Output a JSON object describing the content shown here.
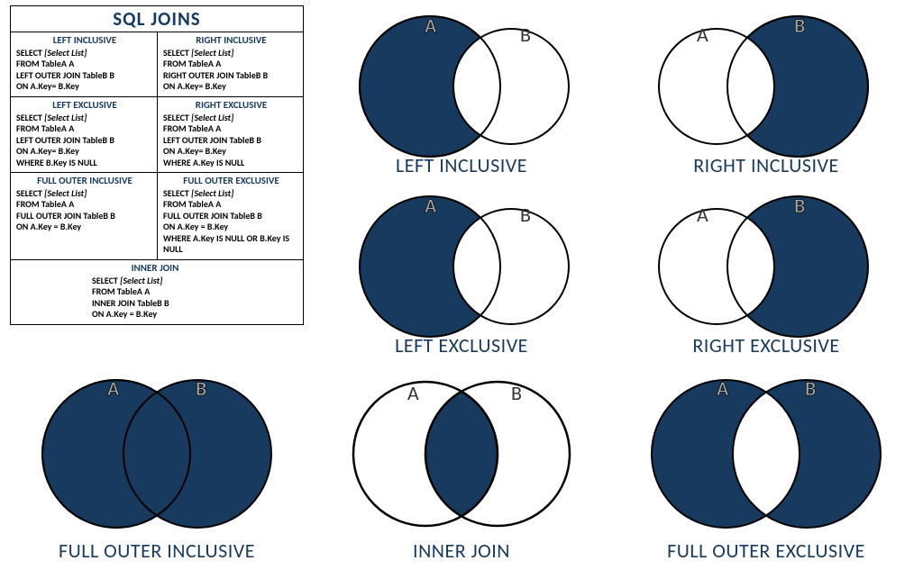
{
  "title": "SQL JOINS",
  "colors": {
    "fill": "#173a5e",
    "stroke": "#000",
    "bg": "#fff"
  },
  "venn": {
    "left_inclusive": {
      "label": "LEFT INCLUSIVE",
      "a": "A",
      "b": "B"
    },
    "right_inclusive": {
      "label": "RIGHT INCLUSIVE",
      "a": "A",
      "b": "B"
    },
    "left_exclusive": {
      "label": "LEFT EXCLUSIVE",
      "a": "A",
      "b": "B"
    },
    "right_exclusive": {
      "label": "RIGHT EXCLUSIVE",
      "a": "A",
      "b": "B"
    },
    "full_outer_inclusive": {
      "label": "FULL OUTER INCLUSIVE",
      "a": "A",
      "b": "B"
    },
    "inner_join": {
      "label": "INNER JOIN",
      "a": "A",
      "b": "B"
    },
    "full_outer_exclusive": {
      "label": "FULL OUTER EXCLUSIVE",
      "a": "A",
      "b": "B"
    }
  },
  "ref": {
    "left_inclusive": {
      "title": "LEFT INCLUSIVE",
      "l1": "SELECT",
      "sl": "[Select List]",
      "l2": "FROM TableA A",
      "l3": "LEFT OUTER JOIN TableB B",
      "l4": "ON A.Key= B.Key"
    },
    "right_inclusive": {
      "title": "RIGHT INCLUSIVE",
      "l1": "SELECT",
      "sl": "[Select List]",
      "l2": "FROM TableA A",
      "l3": "RIGHT OUTER JOIN TableB B",
      "l4": "ON A.Key= B.Key"
    },
    "left_exclusive": {
      "title": "LEFT EXCLUSIVE",
      "l1": "SELECT",
      "sl": "[Select List]",
      "l2": "FROM TableA A",
      "l3": "LEFT OUTER JOIN TableB B",
      "l4": "ON A.Key= B.Key",
      "l5": "WHERE B.Key IS NULL"
    },
    "right_exclusive": {
      "title": "RIGHT EXCLUSIVE",
      "l1": "SELECT",
      "sl": "[Select List]",
      "l2": "FROM TableA A",
      "l3": "LEFT OUTER JOIN TableB B",
      "l4": "ON A.Key= B.Key",
      "l5": "WHERE A.Key IS NULL"
    },
    "full_outer_inclusive": {
      "title": "FULL OUTER INCLUSIVE",
      "l1": "SELECT",
      "sl": "[Select List]",
      "l2": "FROM TableA A",
      "l3": "FULL OUTER JOIN TableB B",
      "l4": "ON A.Key = B.Key"
    },
    "full_outer_exclusive": {
      "title": "FULL OUTER EXCLUSIVE",
      "l1": "SELECT",
      "sl": "[Select List]",
      "l2": "FROM TableA A",
      "l3": "FULL OUTER JOIN TableB B",
      "l4": "ON A.Key = B.Key",
      "l5": "WHERE A.Key IS NULL OR B.Key IS NULL"
    },
    "inner_join": {
      "title": "INNER JOIN",
      "l1": "SELECT",
      "sl": "[Select List]",
      "l2": "FROM TableA A",
      "l3": "INNER JOIN TableB B",
      "l4": "ON A.Key = B.Key"
    }
  }
}
